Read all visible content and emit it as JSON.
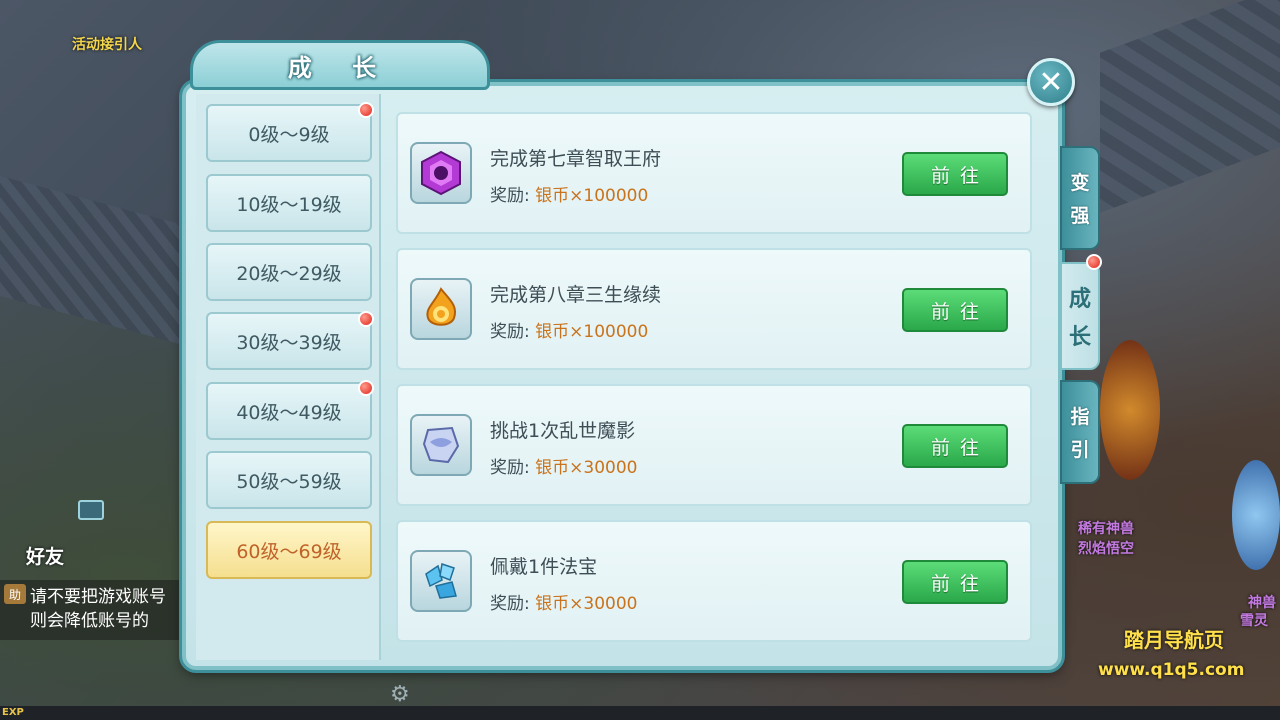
{
  "scene": {
    "npc_top_label": "活动接引人",
    "npc_right_label1": "稀有神兽",
    "npc_right_label2": "烈焰悟空",
    "npc_far_right_label1": "神兽",
    "npc_far_right_label2": "雪灵"
  },
  "panel": {
    "title": "成 长",
    "close_symbol": "✕"
  },
  "levels": [
    {
      "label": "0级～9级",
      "badge": true
    },
    {
      "label": "10级～19级",
      "badge": false
    },
    {
      "label": "20级～29级",
      "badge": false
    },
    {
      "label": "30级～39级",
      "badge": true
    },
    {
      "label": "40级～49级",
      "badge": true
    },
    {
      "label": "50级～59级",
      "badge": false
    },
    {
      "label": "60级～69级",
      "badge": false,
      "selected": true
    }
  ],
  "tasks": [
    {
      "title": "完成第七章智取王府",
      "reward_label": "奖励:",
      "reward_value": "银币×100000",
      "button": "前往",
      "icon": "purple-gem-icon"
    },
    {
      "title": "完成第八章三生缘续",
      "reward_label": "奖励:",
      "reward_value": "银币×100000",
      "button": "前往",
      "icon": "orange-flame-icon"
    },
    {
      "title": "挑战1次乱世魔影",
      "reward_label": "奖励:",
      "reward_value": "银币×30000",
      "button": "前往",
      "icon": "silver-ore-icon"
    },
    {
      "title": "佩戴1件法宝",
      "reward_label": "奖励:",
      "reward_value": "银币×30000",
      "button": "前往",
      "icon": "blue-crystal-icon"
    }
  ],
  "side_tabs": [
    {
      "label_top": "变",
      "label_bottom": "强",
      "selected": false
    },
    {
      "label_top": "成",
      "label_bottom": "长",
      "selected": true
    },
    {
      "label_top": "指",
      "label_bottom": "引",
      "selected": false
    }
  ],
  "chat": {
    "tag": "助",
    "line1": "请不要把游戏账号",
    "line2": "则会降低账号的",
    "friends_label": "好友"
  },
  "bottom": {
    "exp_label": "EXP"
  },
  "watermark": {
    "line1": "踏月导航页",
    "line2": "www.q1q5.com"
  }
}
